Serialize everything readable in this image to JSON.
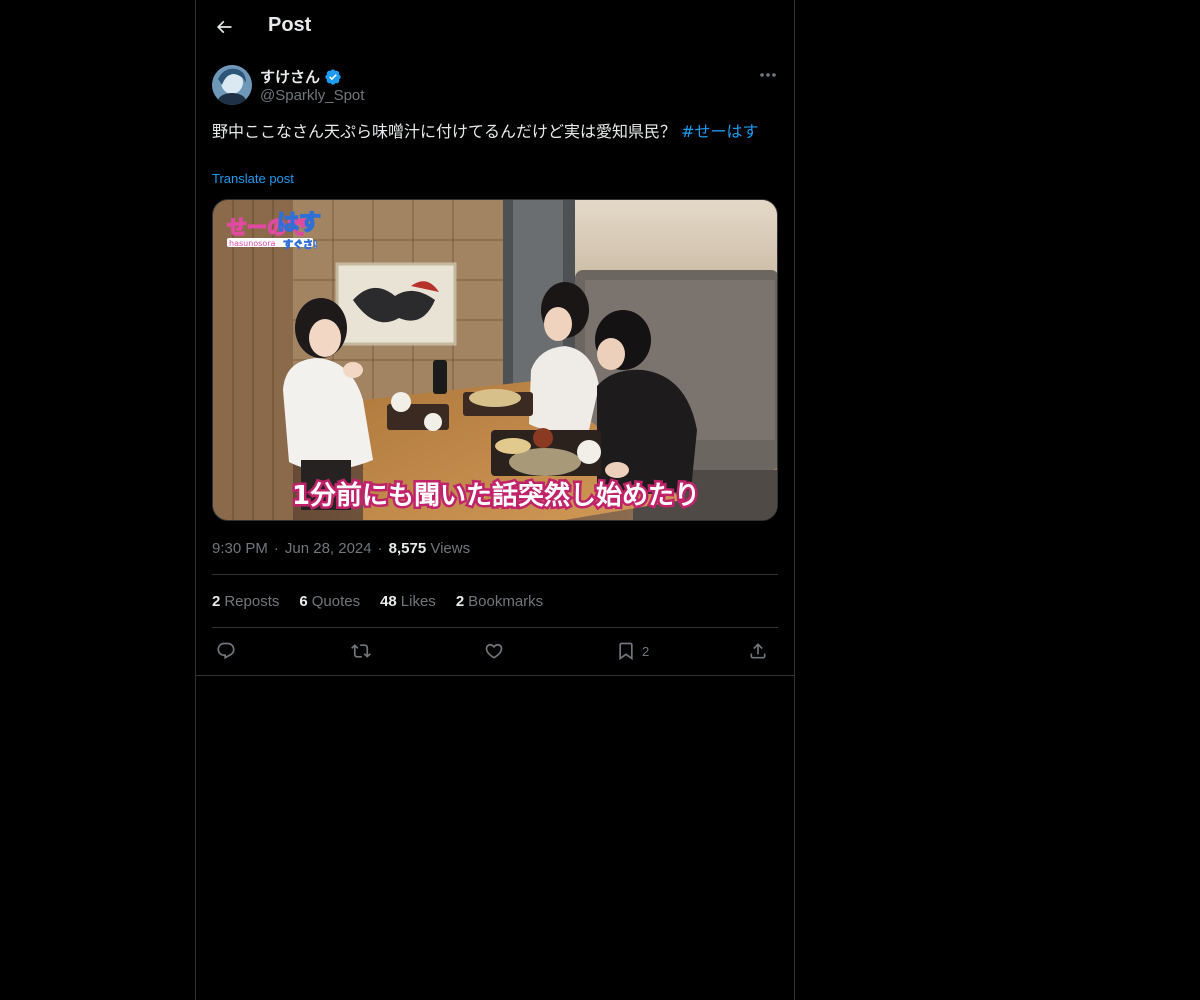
{
  "header": {
    "title": "Post",
    "back_icon": "arrow-left-icon"
  },
  "author": {
    "display_name": "すけさん",
    "handle": "@Sparkly_Spot",
    "verified_icon": "verified-badge-icon",
    "verified_color": "#1d9bf0"
  },
  "post": {
    "text": "野中ここなさん天ぷら味噌汁に付けてるんだけど実は愛知県民？ ",
    "hashtag": "#せーはす",
    "translate_label": "Translate post",
    "media": {
      "overlay_logo": "せーのではすすぐさ!",
      "overlay_sub": "hasunosora",
      "caption": "1分前にも聞いた話突然し始めたり"
    }
  },
  "meta": {
    "time": "9:30 PM",
    "sep1": "·",
    "date": "Jun 28, 2024",
    "sep2": "·",
    "views_count": "8,575",
    "views_label": "Views"
  },
  "stats": {
    "reposts": {
      "count": "2",
      "label": "Reposts"
    },
    "quotes": {
      "count": "6",
      "label": "Quotes"
    },
    "likes": {
      "count": "48",
      "label": "Likes"
    },
    "bookmarks": {
      "count": "2",
      "label": "Bookmarks"
    }
  },
  "actions": {
    "reply_icon": "reply-icon",
    "repost_icon": "repost-icon",
    "like_icon": "heart-icon",
    "bookmark_icon": "bookmark-icon",
    "bookmark_count": "2",
    "share_icon": "share-icon"
  },
  "colors": {
    "background": "#000000",
    "border": "#2f3336",
    "accent": "#1d9bf0",
    "muted": "#71767b",
    "text": "#e7e9ea"
  }
}
